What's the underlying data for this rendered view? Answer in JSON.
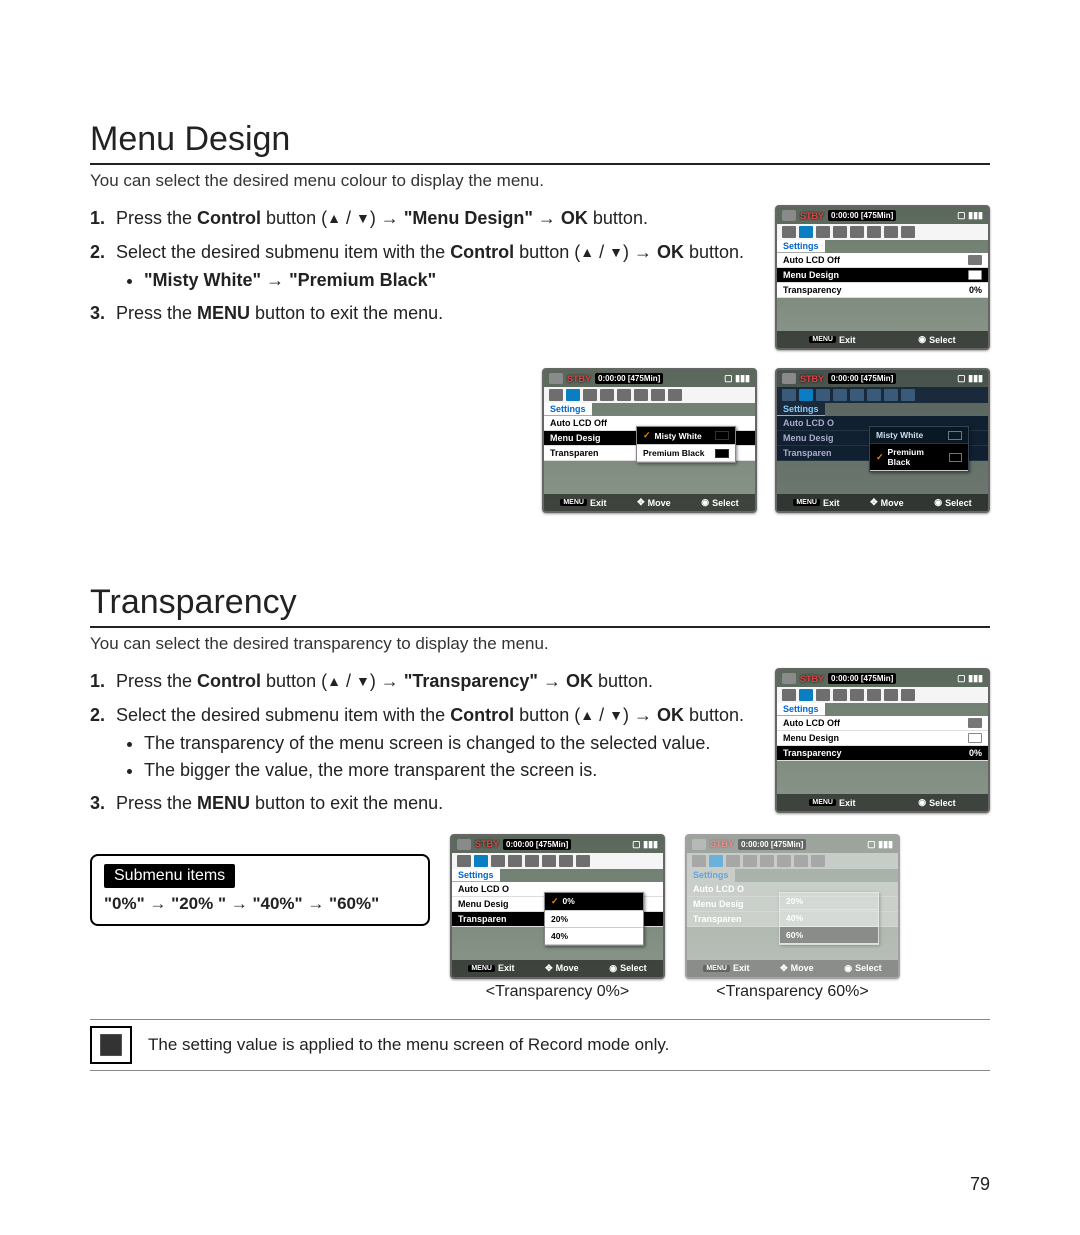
{
  "page_number": "79",
  "section1": {
    "title": "Menu Design",
    "subtitle": "You can select the desired menu colour to display the menu.",
    "step1_a": "Press the ",
    "step1_b": "Control",
    "step1_c": " button (",
    "step1_d": ") → ",
    "step1_e": "\"Menu Design\"",
    "step1_f": " → ",
    "step1_g": "OK",
    "step1_h": " button.",
    "step2_a": "Select the desired submenu item with the ",
    "step2_b": "Control",
    "step2_c": " button (",
    "step2_d": ") → ",
    "step2_e": "OK",
    "step2_f": " button.",
    "step2_bullet": "\"Misty White\" → \"Premium Black\"",
    "step3_a": "Press the ",
    "step3_b": "MENU",
    "step3_c": " button to exit the menu."
  },
  "lcd_common": {
    "stby": "STBY",
    "timecode": "0:00:00 [475Min]",
    "settings": "Settings",
    "row_auto": "Auto LCD Off",
    "row_menu": "Menu Design",
    "row_trans": "Transparency",
    "val_0": "0%",
    "foot_menu": "MENU",
    "foot_exit": "Exit",
    "foot_move": "Move",
    "foot_select": "Select",
    "misty": "Misty White",
    "premium": "Premium Black",
    "p0": "0%",
    "p20": "20%",
    "p40": "40%"
  },
  "section2": {
    "title": "Transparency",
    "subtitle": "You can select the desired transparency to display the menu.",
    "step1_a": "Press the ",
    "step1_b": "Control",
    "step1_c": " button (",
    "step1_d": ") → ",
    "step1_e": "\"Transparency\"",
    "step1_f": " → ",
    "step1_g": "OK",
    "step1_h": " button.",
    "step2_a": "Select the desired submenu item with the ",
    "step2_b": "Control",
    "step2_c": " button (",
    "step2_d": ") → ",
    "step2_e": "OK",
    "step2_f": " button.",
    "step2_bullet1": "The transparency of the menu screen is changed to the selected value.",
    "step2_bullet2": "The bigger the value, the more transparent the screen is.",
    "step3_a": "Press the ",
    "step3_b": "MENU",
    "step3_c": " button to exit the menu.",
    "cap0": "<Transparency 0%>",
    "cap60": "<Transparency 60%>",
    "p60_20": "20%",
    "p60_40": "40%",
    "p60_60": "60%"
  },
  "subbox": {
    "header": "Submenu items",
    "values": "\"0%\" → \"20% \" → \"40%\" → \"60%\""
  },
  "note": "The setting value is applied to the menu screen of Record mode only."
}
